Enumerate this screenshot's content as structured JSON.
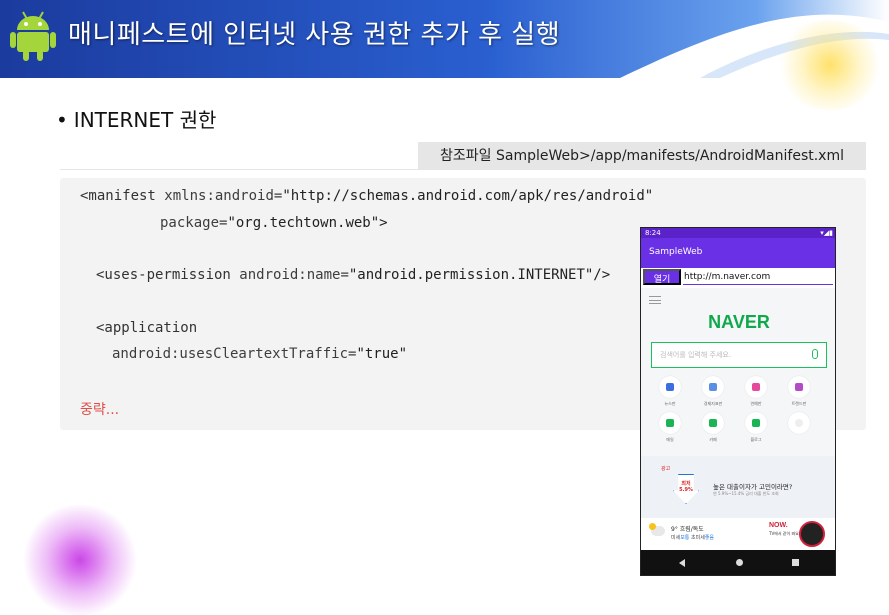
{
  "banner": {
    "title": "매니페스트에 인터넷 사용 권한 추가 후 실행",
    "logo_icon": "android-icon"
  },
  "bullet": {
    "marker": "•",
    "text": "INTERNET 권한"
  },
  "reference": {
    "text": "참조파일 SampleWeb>/app/manifests/AndroidManifest.xml"
  },
  "code": {
    "line1_tag": "<manifest",
    "line1_attr": "xmlns:android=",
    "line1_val": "\"http://schemas.android.com/apk/res/android\"",
    "line2_attr": "package=",
    "line2_val": "\"org.techtown.web\">",
    "line3_tag": "<uses-permission",
    "line3_attr": "android:name=",
    "line3_val": "\"android.permission.INTERNET\"/>",
    "line4_tag": "<application",
    "line5_attr": "android:usesCleartextTraffic=",
    "line5_val": "\"true\"",
    "omitted": "중략..."
  },
  "phone": {
    "status_time": "8:24",
    "status_right": "▾◢▮",
    "app_title": "SampleWeb",
    "open_button": "열기",
    "url_value": "http://m.naver.com",
    "naver_logo": "NAVER",
    "search_placeholder": "검색어를 입력해 주세요.",
    "icons": [
      {
        "label": "뉴스판",
        "color": "#3b6fe0",
        "icon": "news-icon"
      },
      {
        "label": "경제지표판",
        "color": "#5b8fe6",
        "icon": "chart-icon"
      },
      {
        "label": "연예판",
        "color": "#e64a9a",
        "icon": "star-icon"
      },
      {
        "label": "트렌드판",
        "color": "#b44ac7",
        "icon": "heart-icon"
      },
      {
        "label": "메일",
        "color": "#19b453",
        "icon": "mail-icon"
      },
      {
        "label": "카페",
        "color": "#19b453",
        "icon": "cafe-icon"
      },
      {
        "label": "블로그",
        "color": "#19b453",
        "icon": "blog-icon"
      },
      {
        "label": "",
        "color": "#dddddd",
        "icon": "more-icon"
      }
    ],
    "ad_tag": "광고",
    "ad_rate": "최저 5.9%",
    "ad_title": "높은 대출이자가 고민이라면?",
    "ad_sub": "연 5.9%~15.4% 금리 대출 한도 조회",
    "weather_temp": "9° 흐림/독도",
    "weather_dust_label": "미세",
    "weather_dust_value": "보통",
    "weather_ultra_label": "초미세",
    "weather_ultra_value": "좋음",
    "now_logo": "NOW.",
    "now_sub": "TV에서 같이 봐요"
  }
}
